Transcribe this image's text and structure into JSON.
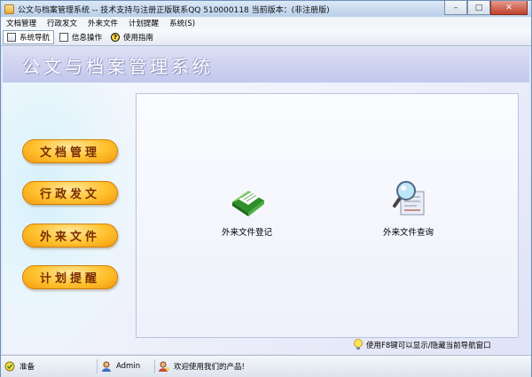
{
  "window": {
    "title": "公文与档案管理系统 -- 技术支持与注册正版联系QQ 510000118   当前版本：(非注册版)",
    "controls": {
      "minimize": "–",
      "maximize": "□",
      "close": "✕"
    }
  },
  "menu": [
    "文档管理",
    "行政发文",
    "外来文件",
    "计划提醒",
    "系统(S)"
  ],
  "toolbar": [
    {
      "label": "系统导航",
      "icon": "nav-icon",
      "active": true
    },
    {
      "label": "信息操作",
      "icon": "info-icon",
      "active": false
    },
    {
      "label": "使用指南",
      "icon": "help-icon",
      "active": false
    }
  ],
  "banner": {
    "title": "公文与档案管理系统"
  },
  "nav_buttons": [
    "文档管理",
    "行政发文",
    "外来文件",
    "计划提醒"
  ],
  "panel_items": [
    {
      "label": "外来文件登记",
      "icon": "green-document-icon"
    },
    {
      "label": "外来文件查询",
      "icon": "magnifier-document-icon"
    }
  ],
  "hint": "使用F8键可以显示/隐藏当前导航窗口",
  "status": {
    "state": "准备",
    "user": "Admin",
    "welcome": "欢迎使用我们的产品!"
  },
  "colors": {
    "accent": "#ffc12e",
    "banner": "#c2c7ec",
    "close_button": "#c0412c"
  }
}
